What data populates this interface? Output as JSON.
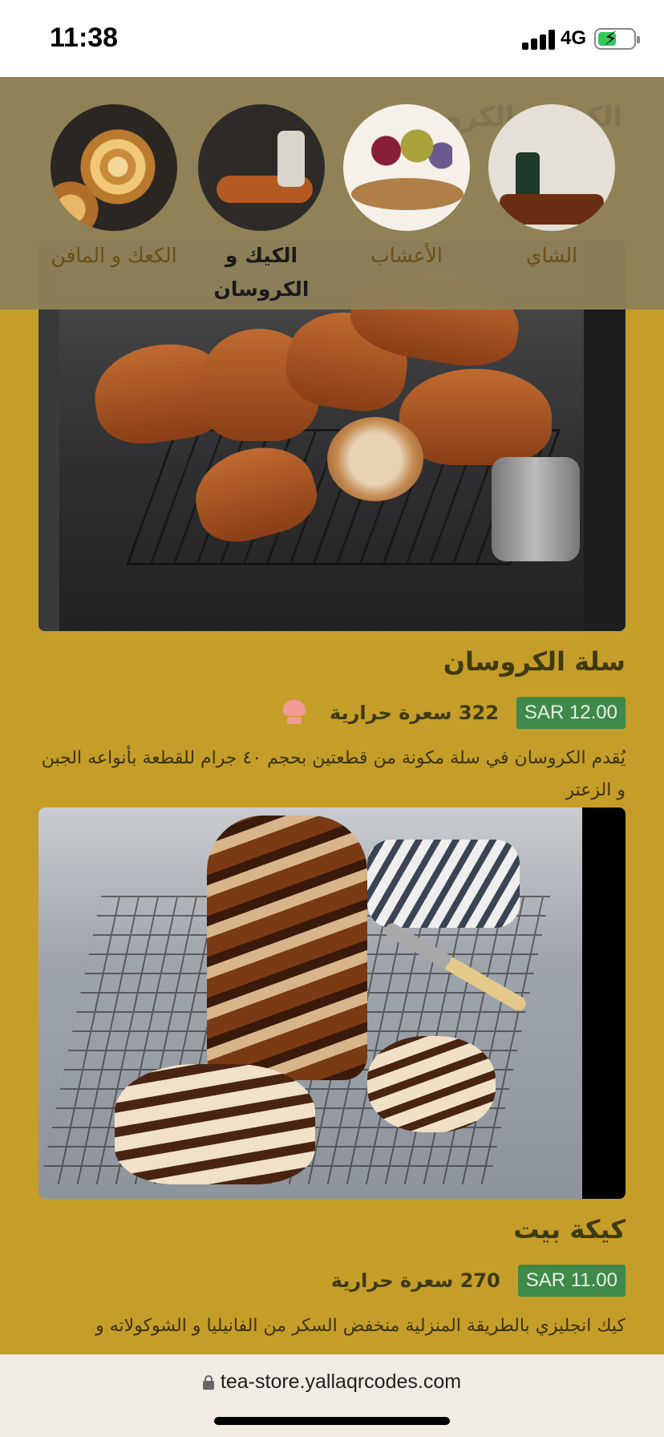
{
  "status_bar": {
    "time": "11:38",
    "network": "4G"
  },
  "header": {
    "ghost_title": "الكيك و الكروسان",
    "categories": [
      {
        "label": "الشاي",
        "image": "tea-image"
      },
      {
        "label": "الأعشاب",
        "image": "herbs-image"
      },
      {
        "label": "الكيك و الكروسان",
        "image": "cake-croissant-image",
        "active": true
      },
      {
        "label": "الكعك و المافن",
        "image": "cookies-muffins-image"
      }
    ]
  },
  "products": [
    {
      "title": "سلة الكروسان",
      "price": "SAR 12.00",
      "calories": "322 سعرة حرارية",
      "description": "يُقدم الكروسان في سلة مكونة من قطعتين بحجم ٤٠ جرام للقطعة بأنواعه الجبن و الزعتر"
    },
    {
      "title": "كيكة بيت",
      "price": "SAR 11.00",
      "calories": "270 سعرة حرارية",
      "description": "كيك انجليزي بالطريقة المنزلية منخفض السكر من الفانيليا و الشوكولاته و"
    }
  ],
  "browser": {
    "url": "tea-store.yallaqrcodes.com"
  },
  "colors": {
    "page_bg": "#c59d29",
    "price_badge": "#3f8a4a",
    "header_overlay": "#8e8058"
  }
}
